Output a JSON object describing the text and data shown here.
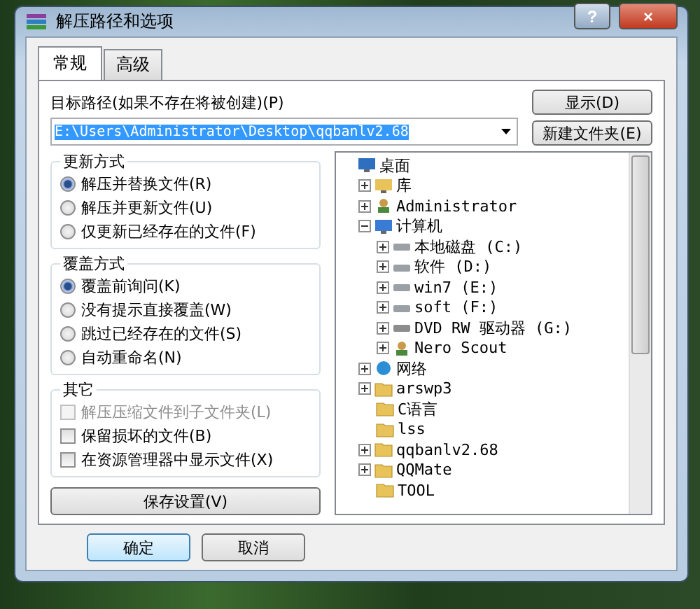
{
  "window": {
    "title": "解压路径和选项",
    "help_button": "?",
    "close_button": "×"
  },
  "tabs": [
    {
      "label": "常规",
      "selected": true
    },
    {
      "label": "高级",
      "selected": false
    }
  ],
  "destination": {
    "label": "目标路径(如果不存在将被创建)(P)",
    "value": "E:\\Users\\Administrator\\Desktop\\qqbanlv2.68"
  },
  "side_buttons": [
    "显示(D)",
    "新建文件夹(E)"
  ],
  "update_mode": {
    "title": "更新方式",
    "options": [
      {
        "label": "解压并替换文件(R)",
        "selected": true
      },
      {
        "label": "解压并更新文件(U)",
        "selected": false
      },
      {
        "label": "仅更新已经存在的文件(F)",
        "selected": false
      }
    ]
  },
  "overwrite_mode": {
    "title": "覆盖方式",
    "options": [
      {
        "label": "覆盖前询问(K)",
        "selected": true
      },
      {
        "label": "没有提示直接覆盖(W)",
        "selected": false
      },
      {
        "label": "跳过已经存在的文件(S)",
        "selected": false
      },
      {
        "label": "自动重命名(N)",
        "selected": false
      }
    ]
  },
  "other": {
    "title": "其它",
    "options": [
      {
        "label": "解压压缩文件到子文件夹(L)",
        "checked": false,
        "disabled": true
      },
      {
        "label": "保留损坏的文件(B)",
        "checked": false,
        "disabled": false
      },
      {
        "label": "在资源管理器中显示文件(X)",
        "checked": false,
        "disabled": false
      }
    ]
  },
  "save_button": "保存设置(V)",
  "tree": [
    {
      "label": "桌面",
      "kind": "desktop",
      "expandable": false,
      "children": [
        {
          "label": "库",
          "kind": "library",
          "expandable": true,
          "expanded": false
        },
        {
          "label": "Administrator",
          "kind": "user",
          "expandable": true,
          "expanded": false
        },
        {
          "label": "计算机",
          "kind": "computer",
          "expandable": true,
          "expanded": true,
          "children": [
            {
              "label": "本地磁盘 (C:)",
              "kind": "drive",
              "expandable": true,
              "expanded": false
            },
            {
              "label": "软件 (D:)",
              "kind": "drive",
              "expandable": true,
              "expanded": false
            },
            {
              "label": "win7 (E:)",
              "kind": "drive",
              "expandable": true,
              "expanded": false
            },
            {
              "label": "soft (F:)",
              "kind": "drive",
              "expandable": true,
              "expanded": false
            },
            {
              "label": "DVD RW 驱动器 (G:)",
              "kind": "dvd",
              "expandable": true,
              "expanded": false
            },
            {
              "label": "Nero Scout",
              "kind": "user",
              "expandable": true,
              "expanded": false
            }
          ]
        },
        {
          "label": "网络",
          "kind": "network",
          "expandable": true,
          "expanded": false
        },
        {
          "label": "arswp3",
          "kind": "folder",
          "expandable": true,
          "expanded": false
        },
        {
          "label": "C语言",
          "kind": "folder",
          "expandable": false
        },
        {
          "label": "lss",
          "kind": "folder",
          "expandable": false
        },
        {
          "label": "qqbanlv2.68",
          "kind": "folder",
          "expandable": true,
          "expanded": false
        },
        {
          "label": "QQMate",
          "kind": "folder",
          "expandable": true,
          "expanded": false
        },
        {
          "label": "TOOL",
          "kind": "folder",
          "expandable": false
        }
      ]
    }
  ],
  "footer_buttons": [
    {
      "label": "确定",
      "selected": true
    },
    {
      "label": "取消",
      "selected": false
    }
  ]
}
